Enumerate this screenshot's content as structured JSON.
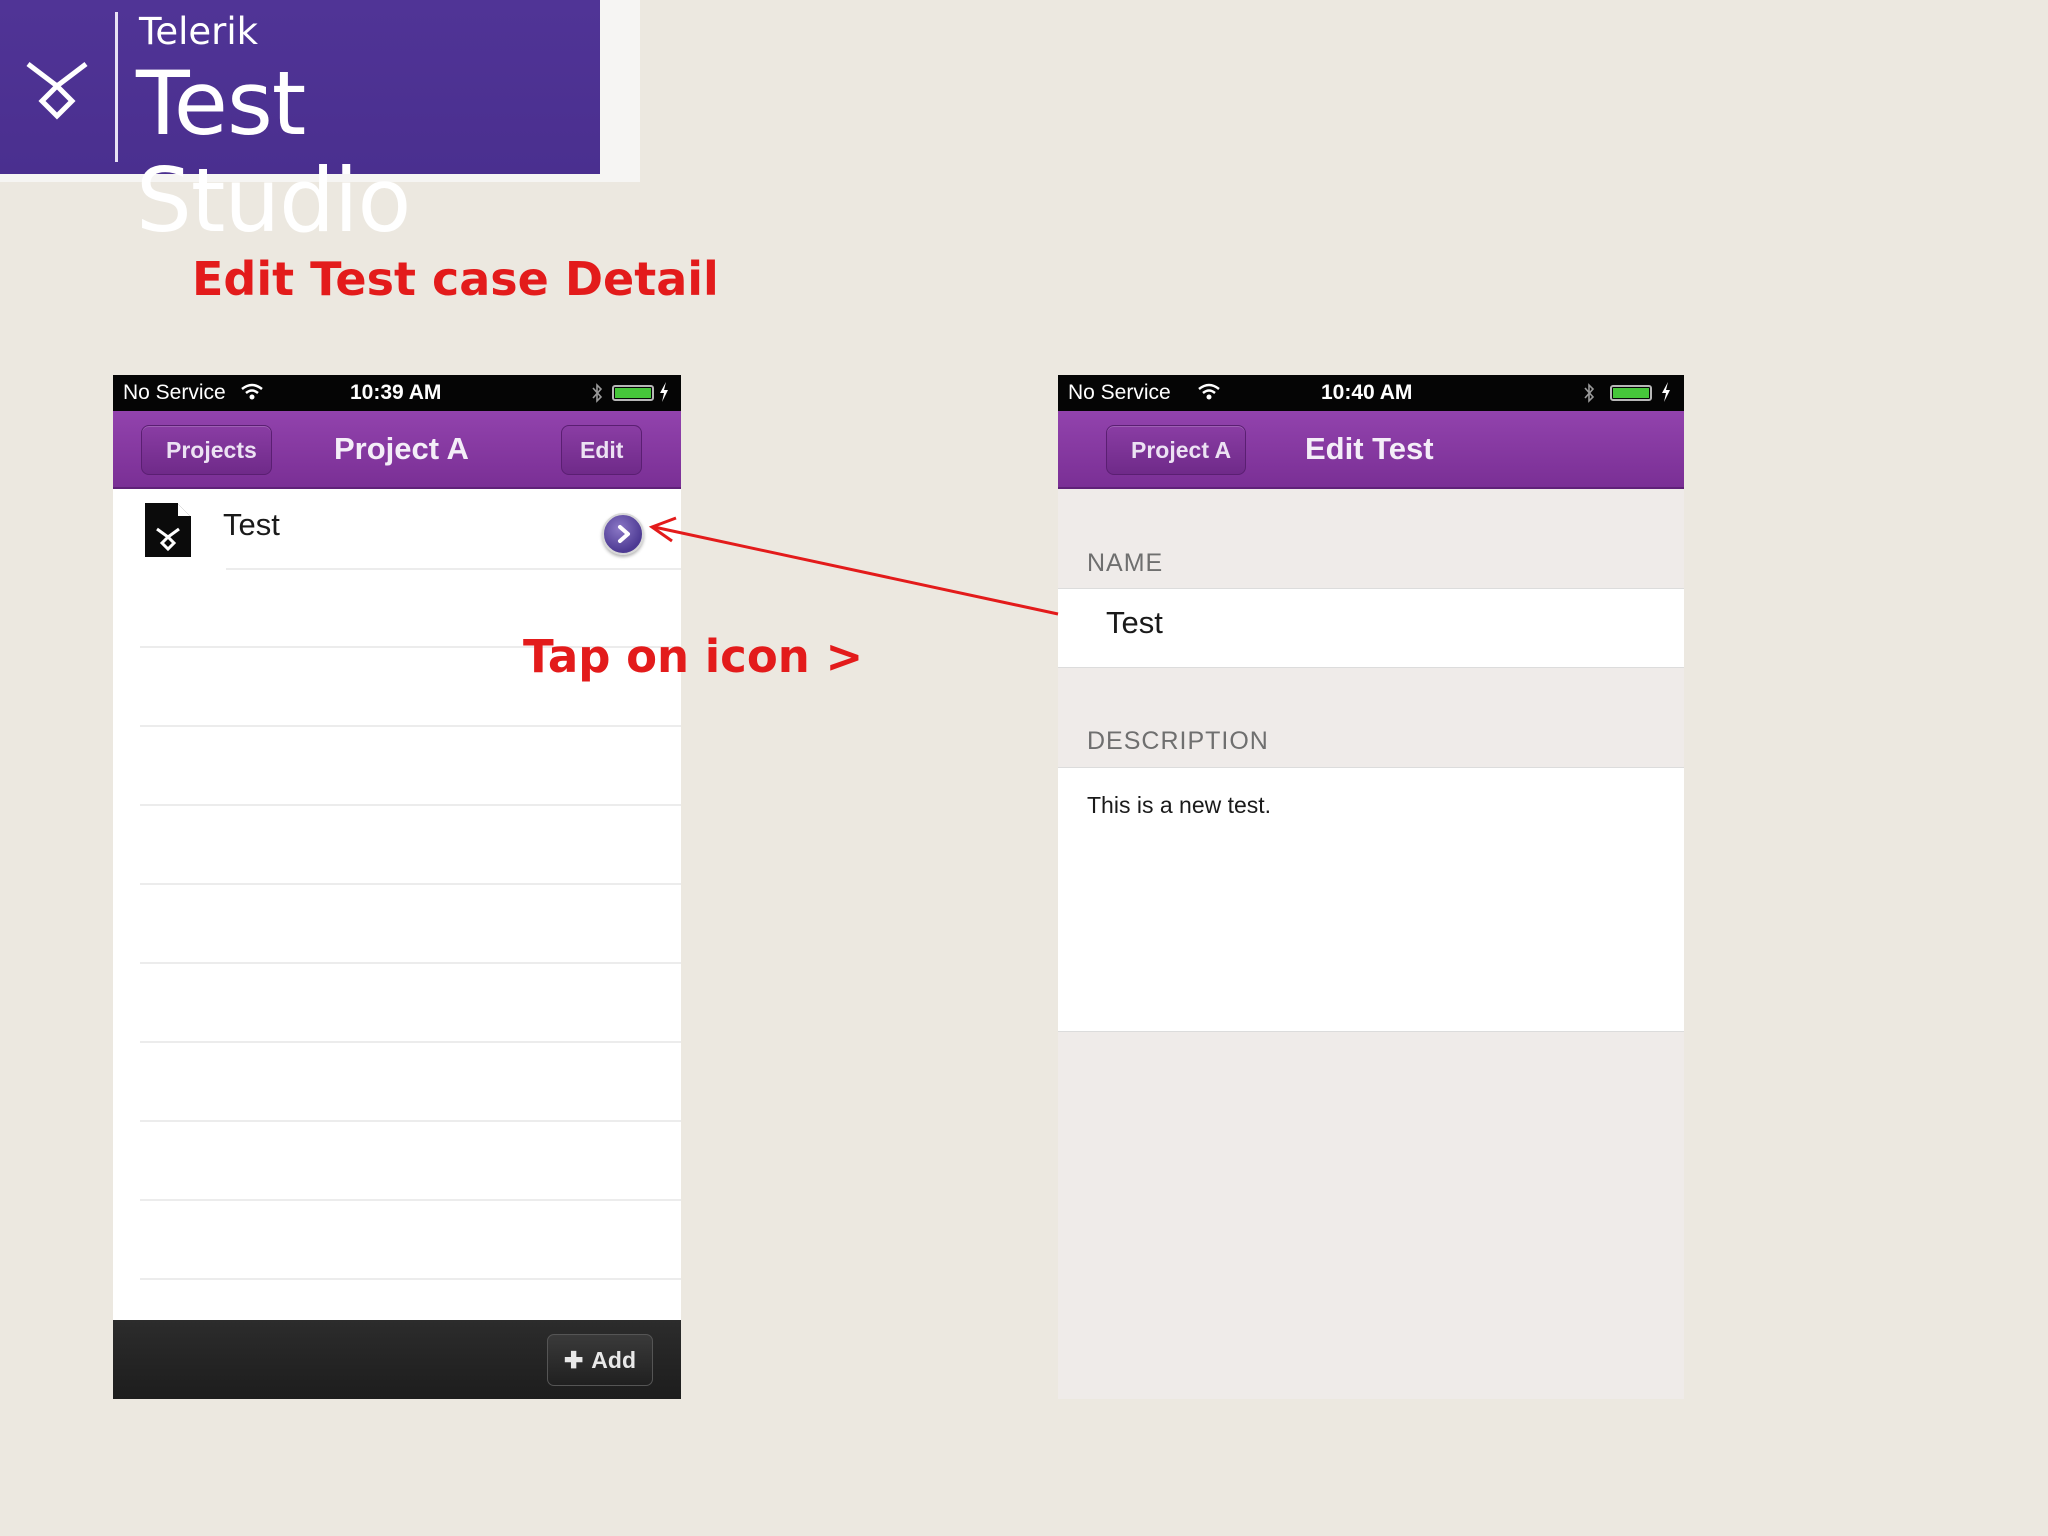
{
  "logo": {
    "brand": "Telerik",
    "product": "Test Studio"
  },
  "slide": {
    "title": "Edit Test case Detail",
    "callout": "Tap on icon >"
  },
  "left_phone": {
    "status": {
      "carrier": "No Service",
      "time": "10:39 AM"
    },
    "nav": {
      "back_label": "Projects",
      "title": "Project A",
      "edit_label": "Edit"
    },
    "list": [
      {
        "label": "Test"
      }
    ],
    "toolbar": {
      "add_label": "Add"
    }
  },
  "right_phone": {
    "status": {
      "carrier": "No Service",
      "time": "10:40 AM"
    },
    "nav": {
      "back_label": "Project A",
      "title": "Edit Test"
    },
    "form": {
      "name_label": "NAME",
      "name_value": "Test",
      "description_label": "DESCRIPTION",
      "description_value": "This is a new test."
    }
  },
  "colors": {
    "brand_purple": "#4f3394",
    "nav_purple": "#8a3aa6",
    "accent_red": "#e31b1b",
    "background": "#ece8e0"
  },
  "icons": [
    "telerik-logo-icon",
    "wifi-icon",
    "bluetooth-icon",
    "battery-icon",
    "document-icon",
    "disclosure-chevron-icon",
    "plus-icon"
  ]
}
